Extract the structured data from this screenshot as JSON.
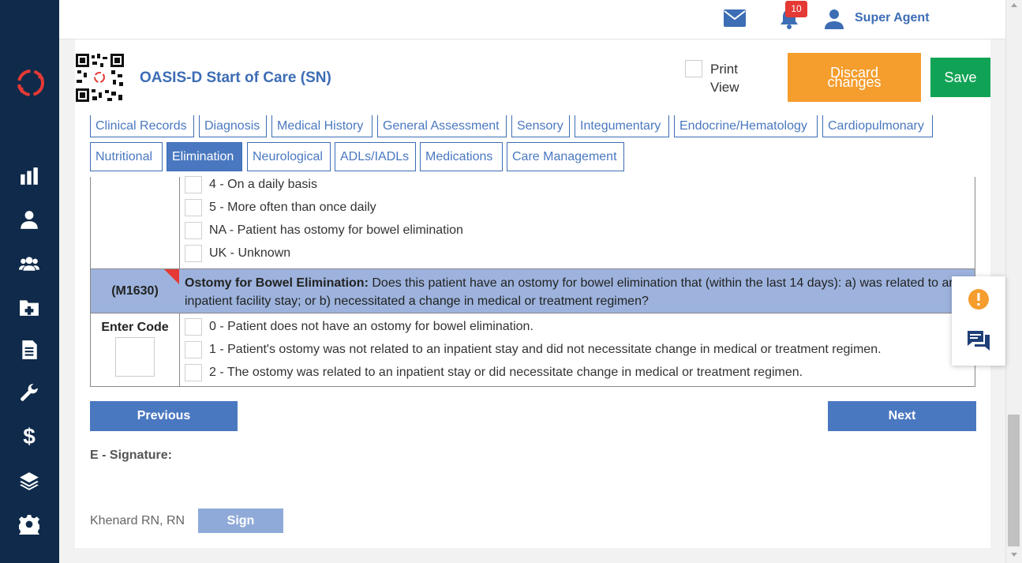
{
  "topbar": {
    "notification_count": "10",
    "username": "Super Agent"
  },
  "header": {
    "title": "OASIS-D Start of Care (SN)",
    "print_view_label": "Print View",
    "discard_label": "Discard changes",
    "save_label": "Save"
  },
  "tabs": {
    "row1": [
      "Clinical Records",
      "Diagnosis",
      "Medical History",
      "General Assessment",
      "Sensory",
      "Integumentary",
      "Endocrine/Hematology",
      "Cardiopulmonary"
    ],
    "row2": [
      "Nutritional",
      "Elimination",
      "Neurological",
      "ADLs/IADLs",
      "Medications",
      "Care Management"
    ],
    "active": "Elimination"
  },
  "prev_question_options": [
    "4 - On a daily basis",
    "5 - More often than once daily",
    "NA - Patient has ostomy for bowel elimination",
    "UK - Unknown"
  ],
  "question": {
    "code": "(M1630)",
    "title": "Ostomy for Bowel Elimination:",
    "text_line1": "Does this patient have an ostomy for bowel elimination that (within the last 14 days): a) was related to an",
    "text_line2": "inpatient facility stay; or b) necessitated a change in medical or treatment regimen?",
    "enter_code_label": "Enter Code",
    "options": [
      "0 - Patient does not have an ostomy for bowel elimination.",
      "1 - Patient's ostomy was not related to an inpatient stay and did not necessitate change in medical or treatment regimen.",
      "2 - The ostomy was related to an inpatient stay or did necessitate change in medical or treatment regimen."
    ]
  },
  "navigation": {
    "previous_label": "Previous",
    "next_label": "Next"
  },
  "signature": {
    "label": "E - Signature:",
    "signer": "Khenard RN, RN",
    "sign_label": "Sign"
  },
  "colors": {
    "sidebar": "#0f2a4a",
    "primary": "#4a78c0",
    "discard": "#f59d2d",
    "save": "#11a355",
    "question_header": "#9db3dd",
    "badge": "#e53935",
    "alert": "#f59d2d"
  }
}
